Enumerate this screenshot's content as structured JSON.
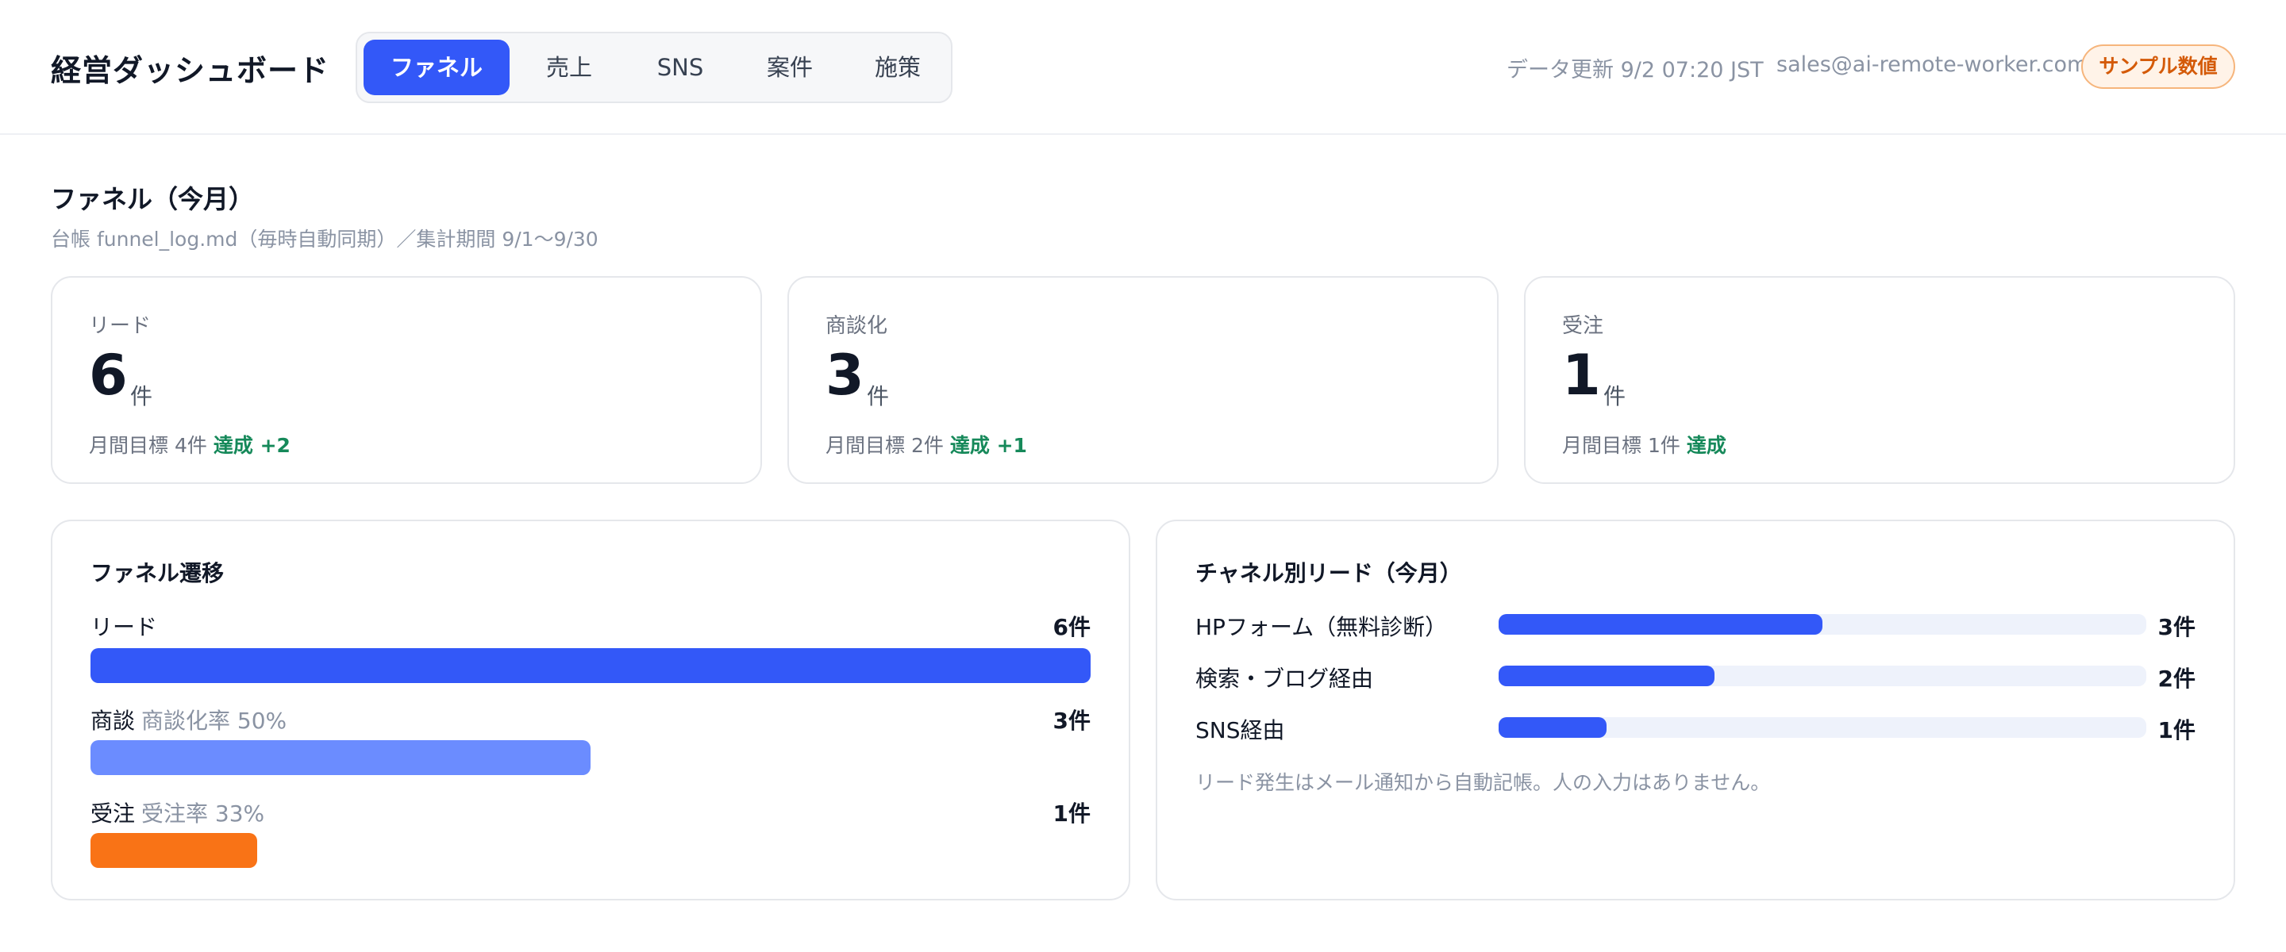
{
  "header": {
    "title": "経営ダッシュボード",
    "tabs": [
      {
        "label": "ファネル",
        "active": true
      },
      {
        "label": "売上",
        "active": false
      },
      {
        "label": "SNS",
        "active": false
      },
      {
        "label": "案件",
        "active": false
      },
      {
        "label": "施策",
        "active": false
      }
    ],
    "updated": "データ更新 9/2 07:20 JST",
    "email": "sales@ai-remote-worker.com",
    "badge": "サンプル数値"
  },
  "section": {
    "title": "ファネル（今月）",
    "subtitle": "台帳 funnel_log.md（毎時自動同期）／集計期間 9/1〜9/30"
  },
  "kpis": [
    {
      "label": "リード",
      "value": "6",
      "unit": "件",
      "target": "月間目標 4件",
      "status": "達成 +2"
    },
    {
      "label": "商談化",
      "value": "3",
      "unit": "件",
      "target": "月間目標 2件",
      "status": "達成 +1"
    },
    {
      "label": "受注",
      "value": "1",
      "unit": "件",
      "target": "月間目標 1件",
      "status": "達成"
    }
  ],
  "funnel": {
    "title": "ファネル遷移",
    "rows": [
      {
        "label": "リード",
        "rate": "",
        "count": "6件",
        "value": 6,
        "color": "#3358f8"
      },
      {
        "label": "商談",
        "rate": "商談化率 50%",
        "count": "3件",
        "value": 3,
        "color": "#6b8cff"
      },
      {
        "label": "受注",
        "rate": "受注率 33%",
        "count": "1件",
        "value": 1,
        "color": "#f97316"
      }
    ]
  },
  "channels": {
    "title": "チャネル別リード（今月）",
    "rows": [
      {
        "label": "HPフォーム（無料診断）",
        "count": "3件",
        "value": 3
      },
      {
        "label": "検索・ブログ経由",
        "count": "2件",
        "value": 2
      },
      {
        "label": "SNS経由",
        "count": "1件",
        "value": 1
      }
    ],
    "note": "リード発生はメール通知から自動記帳。人の入力はありません。"
  },
  "colors": {
    "accent": "#3358f8",
    "success": "#16895a",
    "badge": "#d45a08"
  }
}
